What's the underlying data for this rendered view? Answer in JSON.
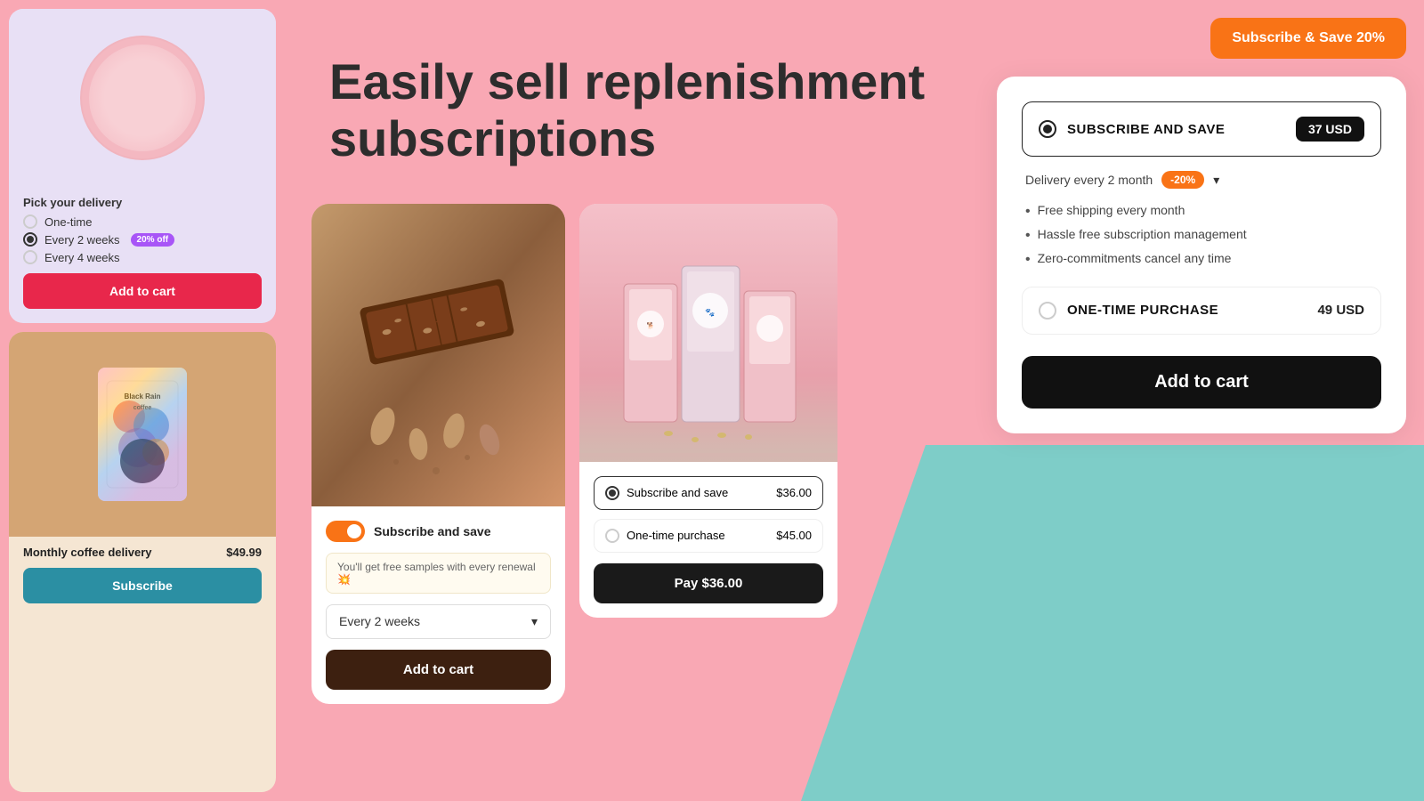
{
  "background": {
    "pink": "#f9a8b4",
    "teal": "#7ecdc8",
    "white": "#ffffff"
  },
  "hero": {
    "title": "Easily sell replenishment subscriptions"
  },
  "subscribe_save_btn": "Subscribe & Save 20%",
  "card_cereal": {
    "delivery_label": "Pick your delivery",
    "options": [
      {
        "label": "One-time",
        "selected": false
      },
      {
        "label": "Every 2 weeks",
        "selected": true,
        "badge": "20% off"
      },
      {
        "label": "Every 4 weeks",
        "selected": false
      }
    ],
    "add_to_cart": "Add to cart"
  },
  "card_coffee": {
    "name": "Monthly coffee delivery",
    "price": "$49.99",
    "subscribe_btn": "Subscribe",
    "bag_label": "Black Rain\ncoffee"
  },
  "card_chocolate": {
    "subscribe_label": "Subscribe and save",
    "free_samples_text": "You'll get free samples with every renewal 💥",
    "frequency": "Every 2 weeks",
    "add_to_cart": "Add to cart"
  },
  "card_dogfood": {
    "options": [
      {
        "label": "Subscribe and save",
        "price": "$36.00",
        "selected": true
      },
      {
        "label": "One-time purchase",
        "price": "$45.00",
        "selected": false
      }
    ],
    "pay_btn": "Pay  $36.00"
  },
  "purchase_panel": {
    "subscribe_option": {
      "label": "SUBSCRIBE AND SAVE",
      "price": "37 USD",
      "selected": true
    },
    "delivery_text": "Delivery every 2 month",
    "discount": "-20%",
    "benefits": [
      "Free shipping every month",
      "Hassle free subscription management",
      "Zero-commitments cancel any time"
    ],
    "onetime_option": {
      "label": "ONE-TIME PURCHASE",
      "price": "49 USD",
      "selected": false
    },
    "add_to_cart": "Add to cart"
  }
}
